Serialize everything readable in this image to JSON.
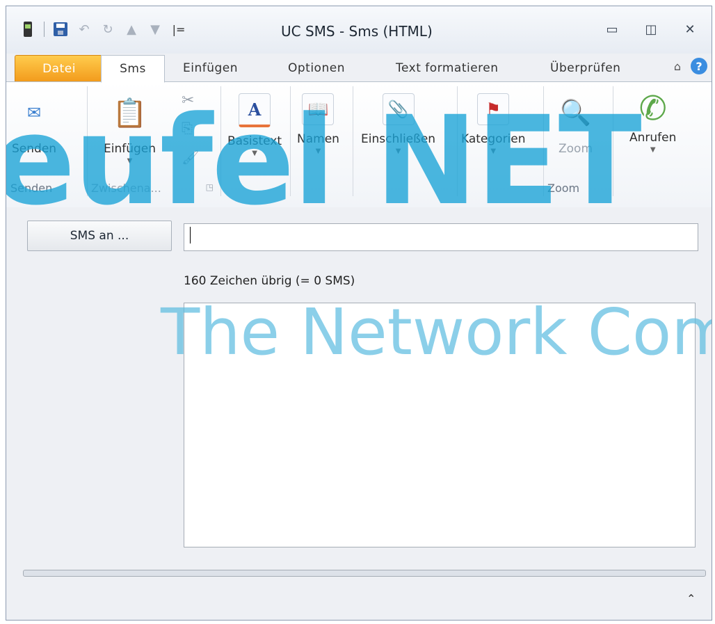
{
  "window": {
    "title": "UC SMS - Sms (HTML)"
  },
  "qat": {
    "separator": "|="
  },
  "tabs": [
    {
      "label": "Datei"
    },
    {
      "label": "Sms"
    },
    {
      "label": "Einfügen"
    },
    {
      "label": "Optionen"
    },
    {
      "label": "Text formatieren"
    },
    {
      "label": "Überprüfen"
    }
  ],
  "ribbon": {
    "send": {
      "button": "Senden",
      "group": "Senden"
    },
    "clipboard": {
      "paste": "Einfügen",
      "group": "Zwischena..."
    },
    "basistext": "Basistext",
    "namen": "Namen",
    "einschliessen": "Einschließen",
    "kategorien": "Kategorien",
    "zoom": {
      "button": "Zoom",
      "group": "Zoom"
    },
    "anrufen": "Anrufen"
  },
  "compose": {
    "sms_to_button": "SMS an ...",
    "to_value": "",
    "counter": "160 Zeichen übrig (= 0 SMS)"
  },
  "watermark": {
    "line1": "eufel NET",
    "line2": "The Network Com"
  },
  "colors": {
    "file_tab": "#f29a1b",
    "watermark": "#19a3d7",
    "help": "#3a8de0"
  }
}
